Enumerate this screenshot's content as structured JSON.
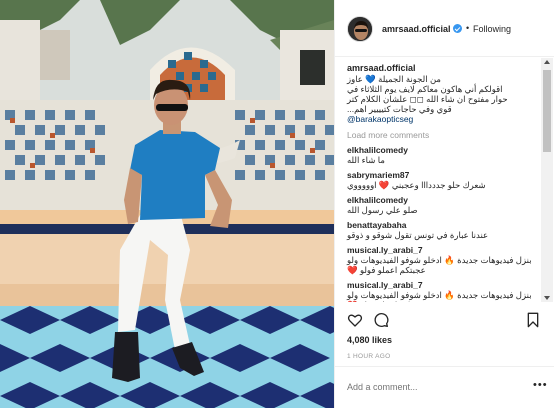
{
  "post": {
    "username": "amrsaad.official",
    "dot": "•",
    "follow_label": "Following",
    "likes": "4,080 likes",
    "timestamp": "1 HOUR AGO",
    "add_comment_placeholder": "Add a comment...",
    "more_options": "•••"
  },
  "caption": {
    "username": "amrsaad.official",
    "lines": [
      "من الجونة الجميلة 💙 عاوز",
      "اقولكم أني هاكون معاكم لايف يوم الثلاثاء في",
      "حوار مفتوح ان شاء الله ◻◻ علشان الكلام كتر",
      "قوي وفي حاجات كتيييير اهم..."
    ],
    "mention": "@barakaopticseg"
  },
  "load_more_label": "Load more comments",
  "comments": [
    {
      "user": "elkhalilcomedy",
      "text": "ما شاء الله"
    },
    {
      "user": "sabrymariem87",
      "text": "شعرك حلو جدددااا وعجبني ❤️ اوووووي"
    },
    {
      "user": "elkhalilcomedy",
      "text": "صلو علي رسول الله"
    },
    {
      "user": "benattayabaha",
      "text": "عندنا عبارة في تونس تقول شوقو و ذوقو"
    },
    {
      "user": "musical.ly_arabi_7",
      "text": "بنزل فيديوهات جديدة 🔥 ادخلو شوفو الفيديوهات ولو عجبتكم اعملو فولو ❤️"
    },
    {
      "user": "musical.ly_arabi_7",
      "text": "بنزل فيديوهات جديدة 🔥 ادخلو شوفو الفيديوهات ولو عجبتكم اعملو فولو ❤️"
    }
  ],
  "colors": {
    "accent": "#3897f0",
    "link": "#003569",
    "muted": "#999999",
    "border": "#efefef"
  },
  "icons": [
    "verified-badge-icon",
    "heart-icon",
    "comment-icon",
    "bookmark-icon",
    "scroll-up-icon",
    "scroll-down-icon"
  ]
}
